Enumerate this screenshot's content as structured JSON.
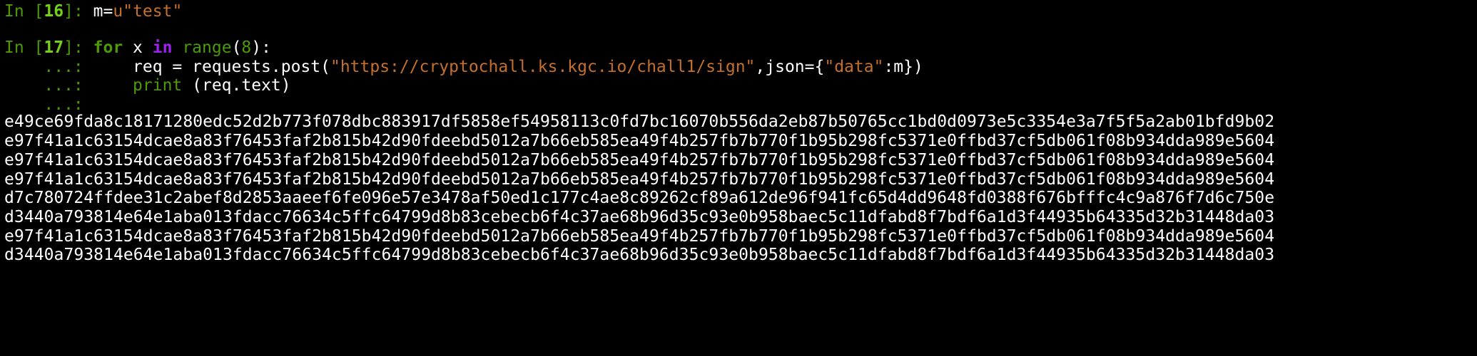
{
  "cells": [
    {
      "prompt_in": "In [",
      "number": "16",
      "prompt_close": "]:",
      "code": {
        "var": "m",
        "eq": "=",
        "prefix": "u",
        "string": "\"test\""
      }
    },
    {
      "prompt_in": "In [",
      "number": "17",
      "prompt_close": "]:",
      "lines": [
        {
          "kw_for": "for",
          "var_x": " x ",
          "kw_in": "in",
          "builtin_range": "range",
          "paren_open": "(",
          "arg": "8",
          "paren_close": "):"
        },
        {
          "cont": "...:",
          "pre": "     req = requests.post(",
          "url": "\"https://cryptochall.ks.kgc.io/chall1/sign\"",
          "mid": ",json={",
          "key": "\"data\"",
          "post": ":m})"
        },
        {
          "cont": "...:",
          "builtin_print": "print",
          "rest": " (req.text)"
        },
        {
          "cont": "...:"
        }
      ]
    }
  ],
  "output_lines": [
    "e49ce69fda8c18171280edc52d2b773f078dbc883917df5858ef54958113c0fd7bc16070b556da2eb87b50765cc1bd0d0973e5c3354e3a7f5f5a2ab01bfd9b02",
    "e97f41a1c63154dcae8a83f76453faf2b815b42d90fdeebd5012a7b66eb585ea49f4b257fb7b770f1b95b298fc5371e0ffbd37cf5db061f08b934dda989e5604",
    "e97f41a1c63154dcae8a83f76453faf2b815b42d90fdeebd5012a7b66eb585ea49f4b257fb7b770f1b95b298fc5371e0ffbd37cf5db061f08b934dda989e5604",
    "e97f41a1c63154dcae8a83f76453faf2b815b42d90fdeebd5012a7b66eb585ea49f4b257fb7b770f1b95b298fc5371e0ffbd37cf5db061f08b934dda989e5604",
    "d7c780724ffdee31c2abef8d2853aaeef6fe096e57e3478af50ed1c177c4ae8c89262cf89a612de96f941fc65d4dd9648fd0388f676bfffc4c9a876f7d6c750e",
    "d3440a793814e64e1aba013fdacc76634c5ffc64799d8b83cebecb6f4c37ae68b96d35c93e0b958baec5c11dfabd8f7bdf6a1d3f44935b64335d32b31448da03",
    "e97f41a1c63154dcae8a83f76453faf2b815b42d90fdeebd5012a7b66eb585ea49f4b257fb7b770f1b95b298fc5371e0ffbd37cf5db061f08b934dda989e5604",
    "d3440a793814e64e1aba013fdacc76634c5ffc64799d8b83cebecb6f4c37ae68b96d35c93e0b958baec5c11dfabd8f7bdf6a1d3f44935b64335d32b31448da03"
  ],
  "colors": {
    "background": "#000000",
    "prompt": "#4e9a06",
    "prompt_number": "#73d216",
    "keyword": "#4e9a06",
    "keyword_in": "#a020f0",
    "string": "#c4702c",
    "text": "#ffffff"
  }
}
